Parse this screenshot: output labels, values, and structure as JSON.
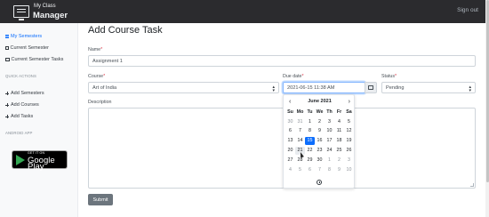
{
  "brand": {
    "line1": "My Class",
    "line2": "Manager"
  },
  "header": {
    "signout": "Sign out"
  },
  "sidebar": {
    "my_semesters": "My Semesters",
    "current_semester": "Current Semester",
    "current_semester_tasks": "Current Semester Tasks",
    "quick_actions_heading": "QUICK ACTIONS",
    "add_semesters": "Add Semesters",
    "add_courses": "Add Courses",
    "add_tasks": "Add Tasks",
    "android_heading": "ANDROID APP",
    "play_small": "GET IT ON",
    "play_big": "Google Play"
  },
  "form": {
    "title": "Add Course Task",
    "name_label": "Name",
    "name_value": "Assignment 1",
    "course_label": "Course",
    "course_value": "Art of India",
    "due_label": "Due date",
    "due_value": "2021-06-15 11:38 AM",
    "status_label": "Status",
    "status_value": "Pending",
    "description_label": "Description",
    "required_mark": "*",
    "submit": "Submit"
  },
  "datepicker": {
    "prev": "‹",
    "next": "›",
    "month": "June 2021",
    "weekdays": [
      "Su",
      "Mo",
      "Tu",
      "We",
      "Th",
      "Fr",
      "Sa"
    ],
    "weeks": [
      [
        "30",
        "31",
        "1",
        "2",
        "3",
        "4",
        "5"
      ],
      [
        "6",
        "7",
        "8",
        "9",
        "10",
        "11",
        "12"
      ],
      [
        "13",
        "14",
        "15",
        "16",
        "17",
        "18",
        "19"
      ],
      [
        "20",
        "21",
        "22",
        "23",
        "24",
        "25",
        "26"
      ],
      [
        "27",
        "28",
        "29",
        "30",
        "1",
        "2",
        "3"
      ],
      [
        "4",
        "5",
        "6",
        "7",
        "8",
        "9",
        "10"
      ]
    ],
    "selected_day": "15",
    "hovered_day": "21"
  },
  "icons": {
    "brand": "monitor-icon",
    "time_toggle": "clock-icon",
    "calendar": "calendar-icon"
  },
  "colors": {
    "accent": "#0d6efd",
    "navbar": "#2b2b2e",
    "submit": "#6c757d",
    "required": "#dc3545"
  }
}
